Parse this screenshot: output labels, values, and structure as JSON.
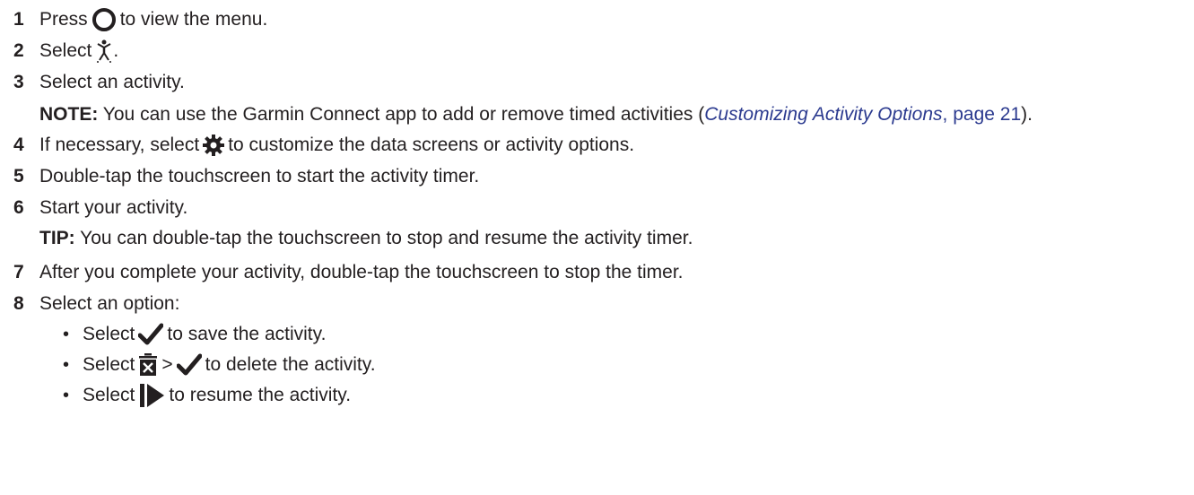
{
  "steps": [
    {
      "num": "1",
      "before": "Press",
      "after": "to view the menu.",
      "icon": "circle-button-icon"
    },
    {
      "num": "2",
      "before": "Select",
      "after": ".",
      "icon": "activity-person-icon"
    },
    {
      "num": "3",
      "text": "Select an activity."
    },
    {
      "num": "4",
      "before": "If necessary, select",
      "after": "to customize the data screens or activity options.",
      "icon": "gear-icon"
    },
    {
      "num": "5",
      "text": "Double-tap the touchscreen to start the activity timer."
    },
    {
      "num": "6",
      "text": "Start your activity."
    },
    {
      "num": "7",
      "text": "After you complete your activity, double-tap the touchscreen to stop the timer."
    },
    {
      "num": "8",
      "text": "Select an option:"
    }
  ],
  "note": {
    "label": "NOTE:",
    "text_before": "You can use the Garmin Connect app to add or remove timed activities (",
    "link_title": "Customizing Activity Options",
    "link_sep": ",",
    "link_page": "page 21",
    "text_after": ")."
  },
  "tip": {
    "label": "TIP:",
    "text": "You can double-tap the touchscreen to stop and resume the activity timer."
  },
  "options": [
    {
      "before": "Select",
      "after": "to save the activity.",
      "icons": [
        "checkmark-icon"
      ]
    },
    {
      "before": "Select",
      "mid": ">",
      "after": "to delete the activity.",
      "icons": [
        "trash-icon",
        "checkmark-icon"
      ]
    },
    {
      "before": "Select",
      "after": "to resume the activity.",
      "icons": [
        "resume-play-icon"
      ]
    }
  ]
}
